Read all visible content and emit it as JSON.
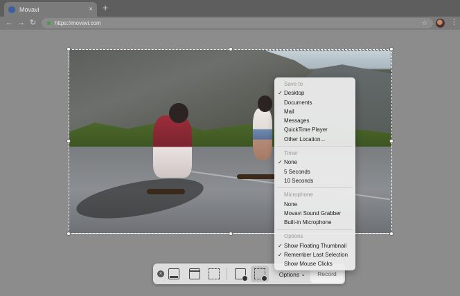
{
  "browser": {
    "tab_title": "Movavi",
    "tab_close": "×",
    "new_tab": "+",
    "url": "https://movavi.com",
    "nav": {
      "back": "←",
      "forward": "→",
      "reload": "↻"
    },
    "star": "☆",
    "menu": "⋮"
  },
  "capture_toolbar": {
    "close": "×",
    "options_label": "Options",
    "options_arrow": "⌄",
    "record_label": "Record",
    "tools": [
      "close-icon",
      "capture-screen-icon",
      "capture-window-icon",
      "capture-selection-icon",
      "record-screen-icon",
      "record-selection-icon"
    ]
  },
  "options_menu": {
    "save_to": {
      "header": "Save to",
      "items": [
        "Desktop",
        "Documents",
        "Mail",
        "Messages",
        "QuickTime Player",
        "Other Location..."
      ],
      "checked": "Desktop"
    },
    "timer": {
      "header": "Timer",
      "items": [
        "None",
        "5 Seconds",
        "10 Seconds"
      ],
      "checked": "None"
    },
    "microphone": {
      "header": "Microphone",
      "items": [
        "None",
        "Movavi Sound Grabber",
        "Built-in Microphone"
      ]
    },
    "options": {
      "header": "Options",
      "items": [
        "Show Floating Thumbnail",
        "Remember Last Selection",
        "Show Mouse Clicks"
      ],
      "checked": [
        "Show Floating Thumbnail",
        "Remember Last Selection"
      ]
    },
    "check_glyph": "✓"
  }
}
